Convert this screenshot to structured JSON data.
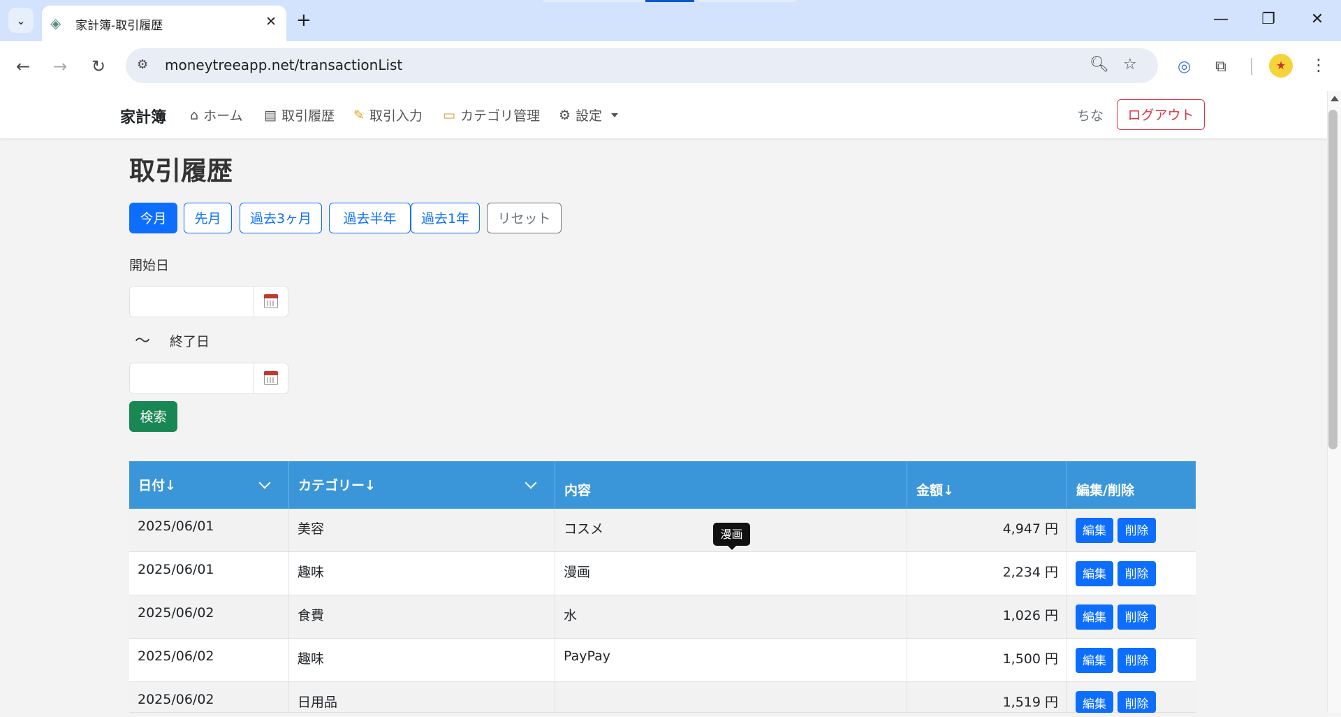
{
  "browser": {
    "tab_title": "家計簿-取引履歴",
    "url": "moneytreeapp.net/transactionList",
    "icons": [
      "tab-search-icon",
      "close-icon",
      "plus-icon",
      "minimize-icon",
      "restore-icon",
      "back-icon",
      "forward-icon",
      "reload-icon",
      "site-info-icon",
      "zoom-icon",
      "star-icon",
      "extension-icon",
      "puzzle-icon",
      "profile-icon",
      "menu-icon"
    ],
    "accent": "#0b57d0"
  },
  "app": {
    "brand": "家計簿",
    "nav": [
      {
        "label": "ホーム",
        "icon": "home-icon"
      },
      {
        "label": "取引履歴",
        "icon": "scroll-icon"
      },
      {
        "label": "取引入力",
        "icon": "pencil-icon"
      },
      {
        "label": "カテゴリ管理",
        "icon": "folder-icon"
      },
      {
        "label": "設定",
        "icon": "gear-icon"
      }
    ],
    "user": "ちな",
    "logout_label": "ログアウト",
    "colors": {
      "primary": "#0d6efd",
      "danger": "#dc3545",
      "success": "#198754",
      "table_header": "#3a96d9"
    }
  },
  "page": {
    "title": "取引履歴",
    "quick_filters": [
      "今月",
      "先月",
      "過去3ヶ月",
      "過去半年",
      "過去1年",
      "リセット"
    ],
    "active_filter": "今月",
    "start_label": "開始日",
    "end_label": "終了日",
    "tilde": "〜",
    "start_value": "",
    "end_value": "",
    "search_label": "検索"
  },
  "table": {
    "headers": [
      "日付↓",
      "カテゴリー↓",
      "内容",
      "金額↓",
      "編集/削除"
    ],
    "edit_label": "編集",
    "delete_label": "削除",
    "rows": [
      {
        "date": "2025/06/01",
        "category": "美容",
        "content": "コスメ",
        "amount": "4,947 円"
      },
      {
        "date": "2025/06/01",
        "category": "趣味",
        "content": "漫画",
        "amount": "2,234 円"
      },
      {
        "date": "2025/06/02",
        "category": "食費",
        "content": "水",
        "amount": "1,026 円"
      },
      {
        "date": "2025/06/02",
        "category": "趣味",
        "content": "PayPay",
        "amount": "1,500 円"
      },
      {
        "date": "2025/06/02",
        "category": "日用品",
        "content": "",
        "amount": "1,519 円"
      }
    ],
    "tooltip": "漫画"
  }
}
